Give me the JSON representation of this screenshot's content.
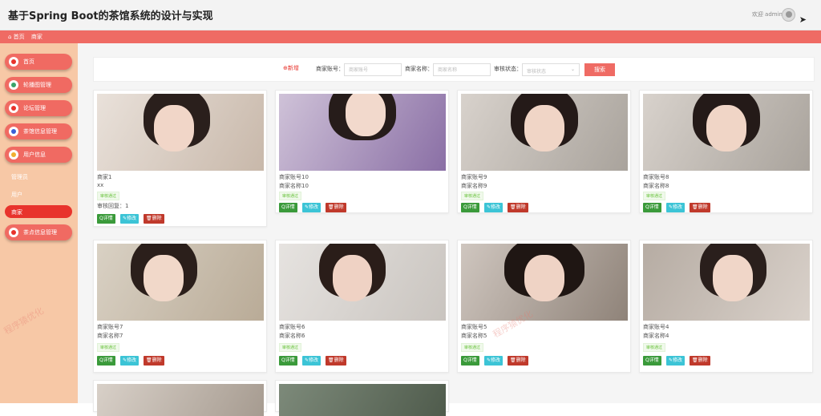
{
  "header": {
    "title": "基于Spring Boot的茶馆系统的设计与实现",
    "welcome": "欢迎 admin"
  },
  "breadcrumb": {
    "home": "⌂ 首页",
    "current": "商家"
  },
  "sidebar": {
    "items": [
      {
        "label": "首页",
        "icon": "home-icon",
        "color": "#e8332c"
      },
      {
        "label": "轮播图管理",
        "icon": "image-icon",
        "color": "#3aa36a"
      },
      {
        "label": "论坛管理",
        "icon": "forum-icon",
        "color": "#e8332c"
      },
      {
        "label": "茶馆信息管理",
        "icon": "info-icon",
        "color": "#3a5fd6"
      },
      {
        "label": "用户信息",
        "icon": "user-icon",
        "color": "#f0b030"
      },
      {
        "label": "茶点信息管理",
        "icon": "snack-icon",
        "color": "#e8332c"
      }
    ],
    "subitems": [
      "管理员",
      "用户",
      "商家"
    ],
    "active": "商家"
  },
  "search": {
    "add_label": "⊕新增",
    "account_label": "商家账号：",
    "account_placeholder": "商家账号",
    "name_label": "商家名称：",
    "name_placeholder": "商家名称",
    "status_label": "审核状态：",
    "status_placeholder": "审核状态",
    "search_button": "搜索"
  },
  "cards": [
    {
      "line1": "商家1",
      "line2": "xx",
      "badge": "审核通过",
      "reply": "审核回复：1"
    },
    {
      "line1": "商家账号10",
      "line2": "商家名称10",
      "badge": "审核通过"
    },
    {
      "line1": "商家账号9",
      "line2": "商家名称9",
      "badge": "审核通过"
    },
    {
      "line1": "商家账号8",
      "line2": "商家名称8",
      "badge": "审核通过"
    },
    {
      "line1": "商家账号7",
      "line2": "商家名称7",
      "badge": "审核通过"
    },
    {
      "line1": "商家账号6",
      "line2": "商家名称6",
      "badge": "审核通过"
    },
    {
      "line1": "商家账号5",
      "line2": "商家名称5",
      "badge": "审核通过"
    },
    {
      "line1": "商家账号4",
      "line2": "商家名称4",
      "badge": "审核通过"
    }
  ],
  "buttons": {
    "detail": "Q详情",
    "edit": "✎修改",
    "delete": "🗑删除"
  },
  "watermarks": [
    "程序猿优化",
    "程序猿优化"
  ],
  "colors": {
    "accent": "#ef6b64",
    "sidebar_bg": "#f7c8a6",
    "active": "#e8332c",
    "detail_btn": "#3a9a3a",
    "edit_btn": "#3cc4d6",
    "delete_btn": "#c0392b"
  }
}
